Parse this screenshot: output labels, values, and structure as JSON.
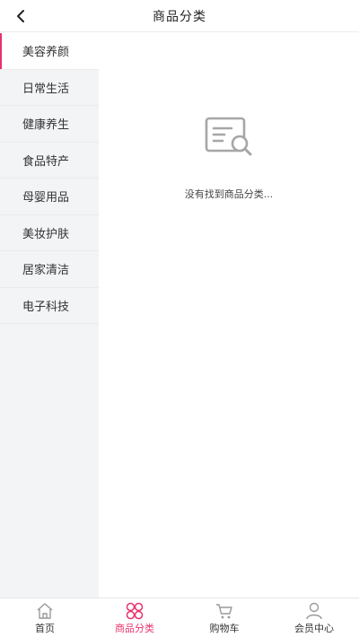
{
  "header": {
    "title": "商品分类",
    "back_icon": "chevron-left-icon"
  },
  "sidebar": {
    "items": [
      {
        "label": "美容养颜",
        "active": true
      },
      {
        "label": "日常生活",
        "active": false
      },
      {
        "label": "健康养生",
        "active": false
      },
      {
        "label": "食品特产",
        "active": false
      },
      {
        "label": "母婴用品",
        "active": false
      },
      {
        "label": "美妆护肤",
        "active": false
      },
      {
        "label": "居家清洁",
        "active": false
      },
      {
        "label": "电子科技",
        "active": false
      }
    ]
  },
  "main": {
    "empty_message": "没有找到商品分类...",
    "empty_icon": "document-search-icon"
  },
  "tabbar": {
    "tabs": [
      {
        "label": "首页",
        "icon": "home-icon",
        "active": false
      },
      {
        "label": "商品分类",
        "icon": "category-icon",
        "active": true
      },
      {
        "label": "购物车",
        "icon": "cart-icon",
        "active": false
      },
      {
        "label": "会员中心",
        "icon": "user-icon",
        "active": false
      }
    ]
  },
  "colors": {
    "accent": "#e8336d",
    "sidebar_bg": "#f3f4f6",
    "icon_gray": "#999999"
  }
}
